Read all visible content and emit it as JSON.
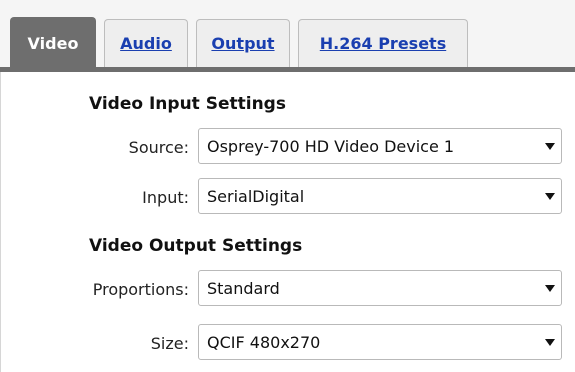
{
  "tabs": [
    {
      "label": "Video",
      "active": true
    },
    {
      "label": "Audio",
      "active": false
    },
    {
      "label": "Output",
      "active": false
    },
    {
      "label": "H.264 Presets",
      "active": false
    }
  ],
  "video_input": {
    "title": "Video Input Settings",
    "source": {
      "label": "Source:",
      "value": "Osprey-700 HD Video Device 1"
    },
    "input": {
      "label": "Input:",
      "value": "SerialDigital"
    }
  },
  "video_output": {
    "title": "Video Output Settings",
    "proportions": {
      "label": "Proportions:",
      "value": "Standard"
    },
    "size": {
      "label": "Size:",
      "value": "QCIF 480x270"
    }
  },
  "colors": {
    "active_tab": "#6e6e6e",
    "link": "#1a3fb0",
    "panel_bg": "#ffffff"
  }
}
